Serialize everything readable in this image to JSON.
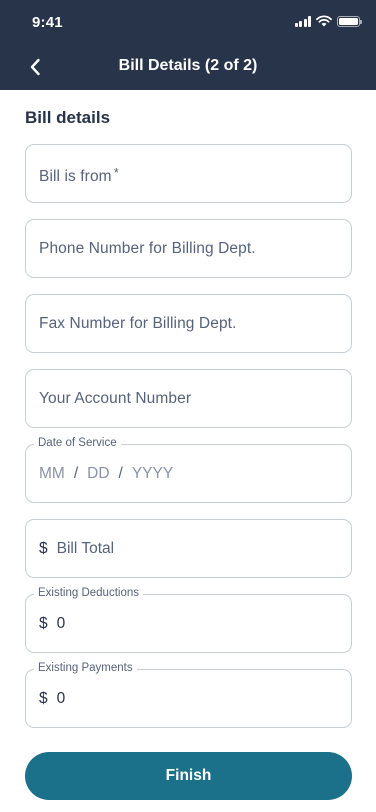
{
  "status_bar": {
    "time": "9:41"
  },
  "nav": {
    "title": "Bill Details (2 of 2)"
  },
  "form": {
    "section_title": "Bill details",
    "bill_from": {
      "placeholder": "Bill is from",
      "required_mark": "*"
    },
    "billing_phone": {
      "placeholder": "Phone Number for Billing Dept."
    },
    "billing_fax": {
      "placeholder": "Fax Number for Billing Dept."
    },
    "account_number": {
      "placeholder": "Your Account Number"
    },
    "date_of_service": {
      "label": "Date of Service",
      "mm": "MM",
      "dd": "DD",
      "yyyy": "YYYY",
      "separator": "/"
    },
    "bill_total": {
      "currency": "$",
      "placeholder": "Bill Total"
    },
    "existing_deductions": {
      "label": "Existing Deductions",
      "currency": "$",
      "value": "0"
    },
    "existing_payments": {
      "label": "Existing Payments",
      "currency": "$",
      "value": "0"
    }
  },
  "actions": {
    "finish_label": "Finish"
  },
  "colors": {
    "header_bg": "#28344a",
    "primary_button": "#1b708a",
    "field_border": "#c9ced6"
  }
}
